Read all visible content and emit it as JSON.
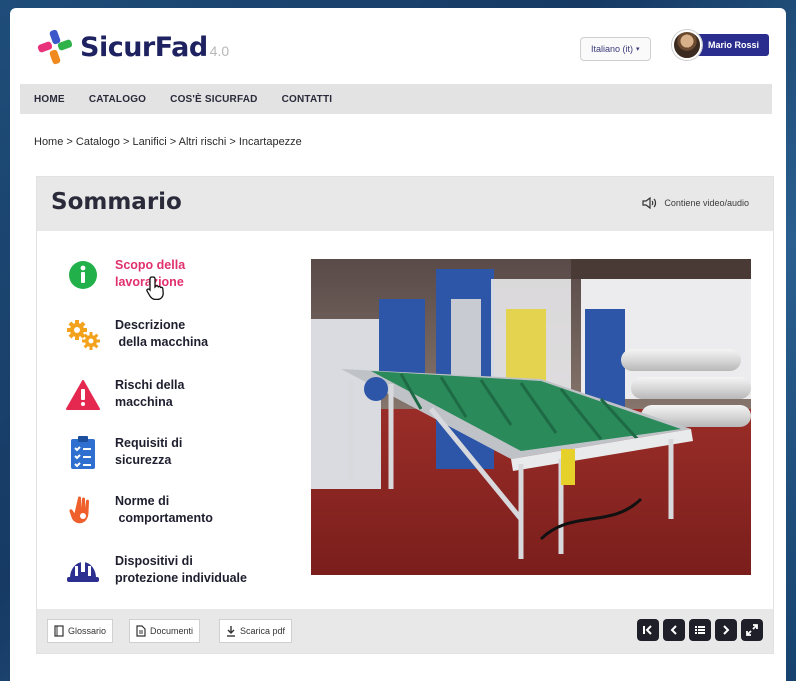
{
  "app": {
    "logo_text": "SicurFad",
    "logo_version": "4.0",
    "language": "Italiano (it)",
    "user_name": "Mario Rossi"
  },
  "nav": {
    "items": [
      "HOME",
      "CATALOGO",
      "COS'È SICURFAD",
      "CONTATTI"
    ]
  },
  "breadcrumb": "Home > Catalogo > Lanifici > Altri rischi > Incartapezze",
  "panel": {
    "title": "Sommario",
    "media_note": "Contiene video/audio"
  },
  "menu": {
    "items": [
      {
        "label": "Scopo della\nlavorazione",
        "icon": "info-icon",
        "active": true
      },
      {
        "label": "Descrizione\n della macchina",
        "icon": "gears-icon",
        "active": false
      },
      {
        "label": "Rischi della\nmacchina",
        "icon": "warning-icon",
        "active": false
      },
      {
        "label": "Requisiti di\nsicurezza",
        "icon": "checklist-icon",
        "active": false
      },
      {
        "label": "Norme di\n comportamento",
        "icon": "hand-icon",
        "active": false
      },
      {
        "label": "Dispositivi di\nprotezione individuale",
        "icon": "helmet-icon",
        "active": false
      }
    ]
  },
  "footer": {
    "glossary_label": "Glossario",
    "documents_label": "Documenti",
    "download_label": "Scarica pdf"
  },
  "colors": {
    "brand_navy": "#2b2d8e",
    "active_pink": "#e0306e",
    "header_gray": "#e8e8e8"
  }
}
